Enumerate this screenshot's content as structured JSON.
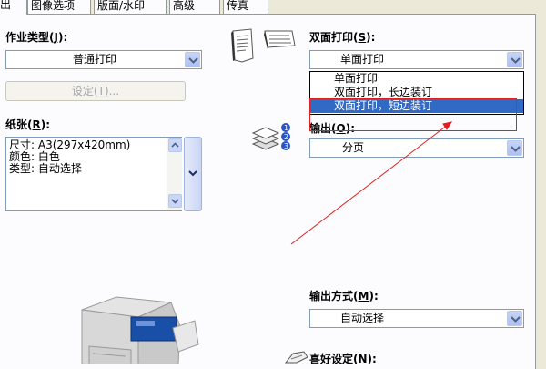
{
  "tabs": [
    {
      "label": "出"
    },
    {
      "label": "图像选项"
    },
    {
      "label": "版面/水印"
    },
    {
      "label": "高级"
    },
    {
      "label": "传真"
    }
  ],
  "job_type": {
    "label_main": "作业类型(",
    "label_key": "J",
    "label_end": "):",
    "value": "普通打印",
    "settings_button": "设定(T)..."
  },
  "paper": {
    "label_main": "纸张(",
    "label_key": "R",
    "label_end": "):",
    "lines": [
      "尺寸: A3(297x420mm)",
      "颜色: 白色",
      "类型: 自动选择"
    ]
  },
  "duplex": {
    "label_main": "双面打印(",
    "label_key": "S",
    "label_end": "):",
    "value": "单面打印",
    "options": [
      "单面打印",
      "双面打印，长边装订",
      "双面打印，短边装订"
    ],
    "selected_index": 2
  },
  "output": {
    "label_main": "输出(",
    "label_key": "O",
    "label_end": "):",
    "value": "分页"
  },
  "output_method": {
    "label_main": "输出方式(",
    "label_key": "M",
    "label_end": "):",
    "value": "自动选择"
  },
  "favorites": {
    "label_main": "喜好设定(",
    "label_key": "N",
    "label_end": "):"
  },
  "colors": {
    "highlight": "#316ac5",
    "annotation": "#e02020"
  }
}
